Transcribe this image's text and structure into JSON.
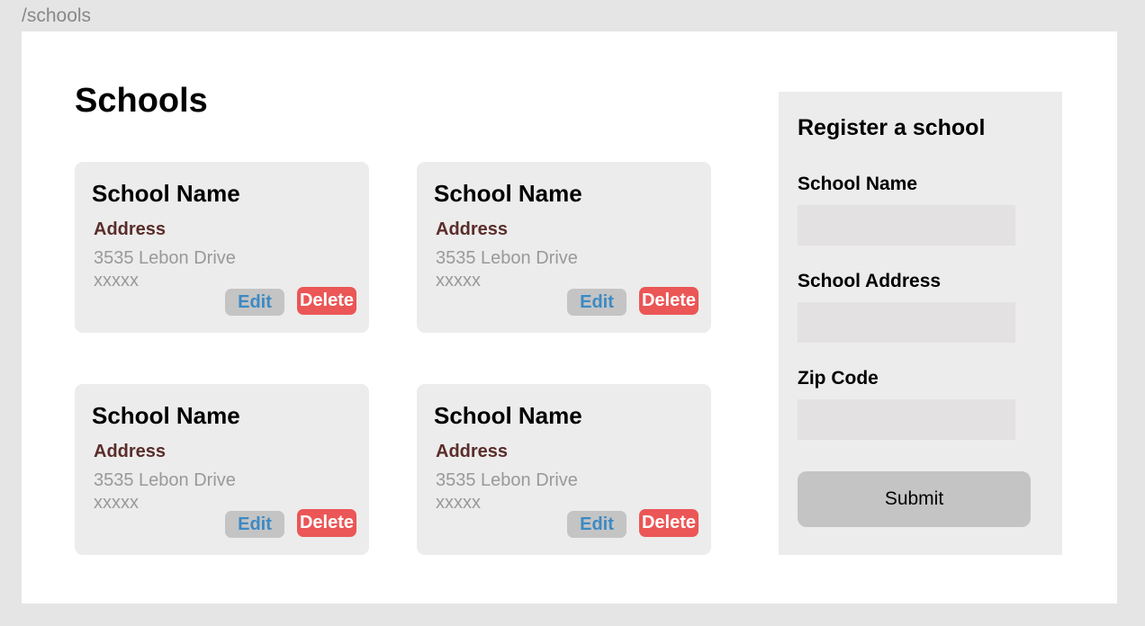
{
  "route": "/schools",
  "page_title": "Schools",
  "schools": [
    {
      "name": "School Name",
      "address_label": "Address",
      "street": "3535 Lebon Drive",
      "zip": "xxxxx",
      "edit_label": "Edit",
      "delete_label": "Delete"
    },
    {
      "name": "School Name",
      "address_label": "Address",
      "street": "3535 Lebon Drive",
      "zip": "xxxxx",
      "edit_label": "Edit",
      "delete_label": "Delete"
    },
    {
      "name": "School Name",
      "address_label": "Address",
      "street": "3535 Lebon Drive",
      "zip": "xxxxx",
      "edit_label": "Edit",
      "delete_label": "Delete"
    },
    {
      "name": "School Name",
      "address_label": "Address",
      "street": "3535 Lebon Drive",
      "zip": "xxxxx",
      "edit_label": "Edit",
      "delete_label": "Delete"
    }
  ],
  "register": {
    "title": "Register a school",
    "fields": [
      {
        "label": "School Name",
        "value": ""
      },
      {
        "label": "School Address",
        "value": ""
      },
      {
        "label": "Zip Code",
        "value": ""
      }
    ],
    "submit_label": "Submit"
  },
  "colors": {
    "delete": "#eb5656",
    "edit_text": "#3b8ac4",
    "address_label": "#5a2d2a"
  }
}
